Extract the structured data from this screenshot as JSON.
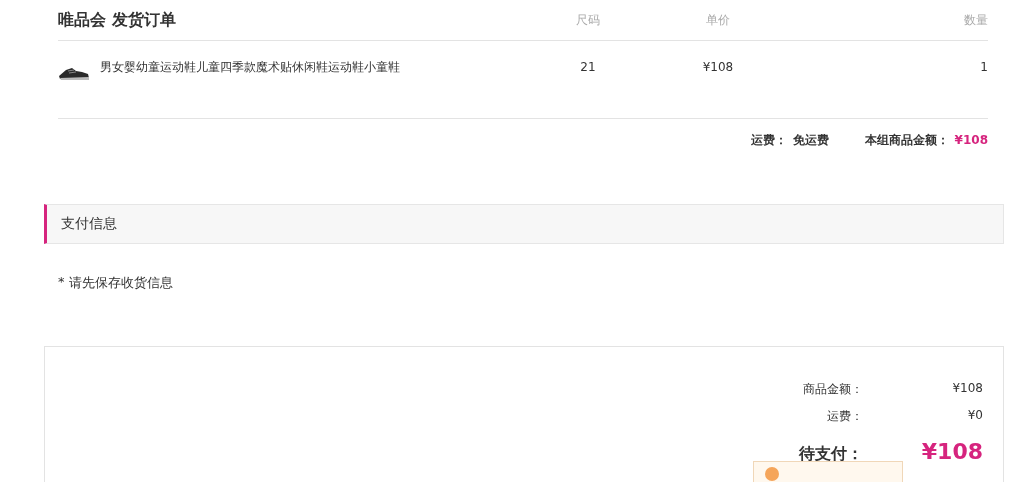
{
  "order": {
    "title": "唯品会 发货订单",
    "columns": [
      "尺码",
      "单价",
      "数量"
    ],
    "items": [
      {
        "name": "男女婴幼童运动鞋儿童四季款魔术贴休闲鞋运动鞋小童鞋",
        "size": "21",
        "price": "¥108",
        "quantity": "1"
      }
    ],
    "shipping_label": "运费：",
    "shipping_value": "免运费",
    "subtotal_label": "本组商品金额：",
    "subtotal_value": "¥108"
  },
  "payment": {
    "title": "支付信息",
    "note_mark": "*",
    "note": "请先保存收货信息"
  },
  "summary": {
    "rows": [
      {
        "label": "商品金额：",
        "value": "¥108"
      },
      {
        "label": "运费：",
        "value": "¥0"
      }
    ],
    "due_label": "待支付：",
    "due_value": "¥108"
  }
}
